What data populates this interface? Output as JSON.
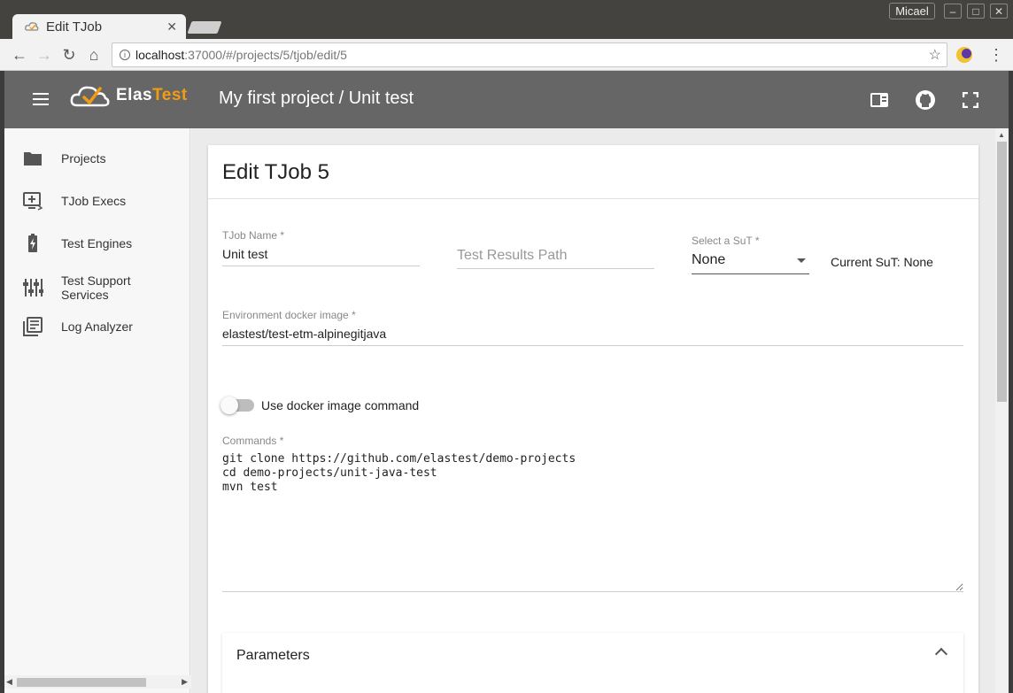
{
  "browser": {
    "tab_title": "Edit TJob",
    "tab_close": "✕",
    "user_name": "Micael",
    "url_host": "localhost",
    "url_path": ":37000/#/projects/5/tjob/edit/5"
  },
  "app": {
    "logo_text_main": "Elas",
    "logo_text_accent": "Test",
    "breadcrumb": "My first project / Unit test",
    "accent_color": "#f39c12",
    "header_color": "#666666"
  },
  "sidebar": {
    "items": [
      {
        "label": "Projects",
        "icon": "folder-icon"
      },
      {
        "label": "TJob Execs",
        "icon": "add-to-queue-icon"
      },
      {
        "label": "Test Engines",
        "icon": "battery-charging-icon"
      },
      {
        "label": "Test Support Services",
        "icon": "tune-icon"
      },
      {
        "label": "Log Analyzer",
        "icon": "library-books-icon"
      }
    ]
  },
  "form": {
    "title": "Edit TJob 5",
    "tjob_name_label": "TJob Name *",
    "tjob_name_value": "Unit test",
    "results_path_placeholder": "Test Results Path",
    "sut_label": "Select a SuT *",
    "sut_value": "None",
    "current_sut": "Current SuT: None",
    "docker_image_label": "Environment docker image *",
    "docker_image_value": "elastest/test-etm-alpinegitjava",
    "use_docker_command_label": "Use docker image command",
    "use_docker_command_on": false,
    "commands_label": "Commands *",
    "commands_value": "git clone https://github.com/elastest/demo-projects\ncd demo-projects/unit-java-test\nmvn test",
    "parameters_title": "Parameters"
  }
}
